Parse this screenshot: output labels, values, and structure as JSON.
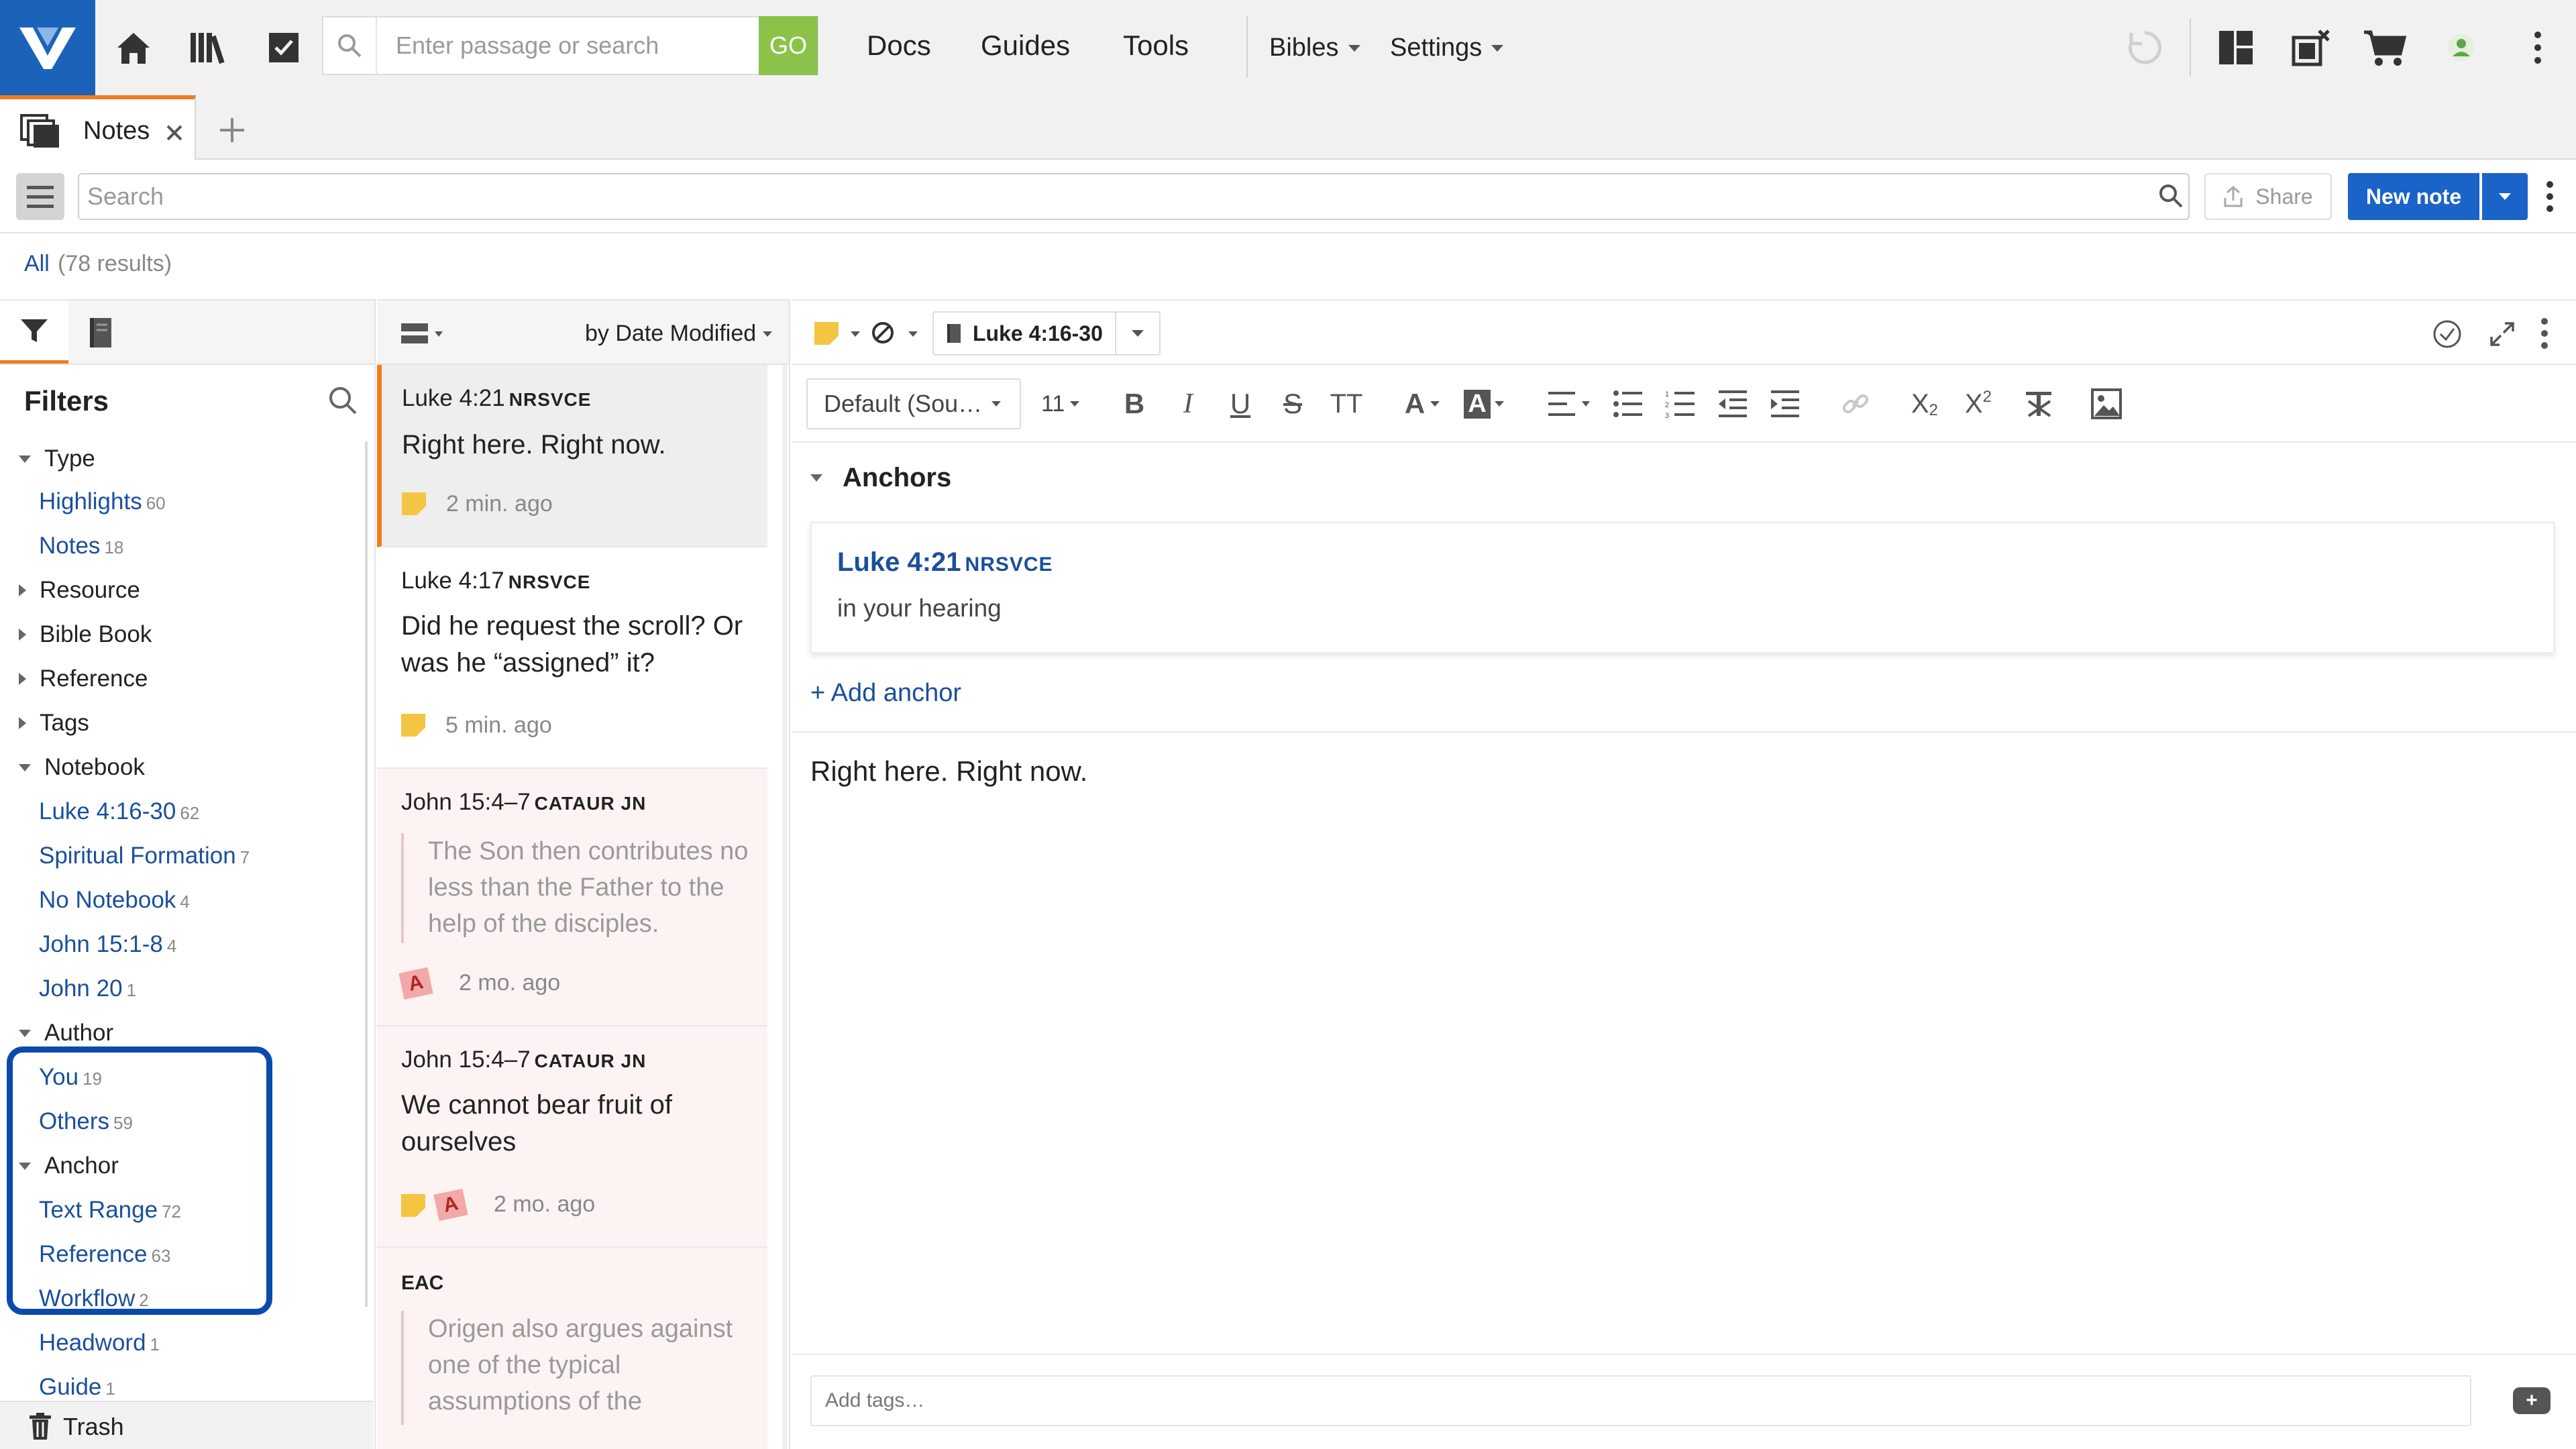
{
  "topbar": {
    "search_placeholder": "Enter passage or search",
    "go_label": "GO",
    "nav": [
      "Docs",
      "Guides",
      "Tools"
    ],
    "bibles_label": "Bibles",
    "settings_label": "Settings",
    "brand_color": "#1a63b8",
    "go_color": "#8bc34a"
  },
  "tab": {
    "label": "Notes",
    "accent": "#f07c1e"
  },
  "toolbar": {
    "search_placeholder": "Search",
    "share_label": "Share",
    "new_note_label": "New note",
    "new_note_color": "#1a63c8"
  },
  "results": {
    "all_label": "All",
    "count_label": "(78 results)"
  },
  "filters": {
    "title": "Filters",
    "groups": {
      "type": {
        "label": "Type",
        "items": [
          {
            "label": "Highlights",
            "count": "60"
          },
          {
            "label": "Notes",
            "count": "18"
          }
        ]
      },
      "resource": {
        "label": "Resource"
      },
      "bible_book": {
        "label": "Bible Book"
      },
      "reference": {
        "label": "Reference"
      },
      "tags": {
        "label": "Tags"
      },
      "notebook": {
        "label": "Notebook",
        "items": [
          {
            "label": "Luke 4:16-30",
            "count": "62"
          },
          {
            "label": "Spiritual Formation",
            "count": "7"
          },
          {
            "label": "No Notebook",
            "count": "4"
          },
          {
            "label": "John 15:1-8",
            "count": "4"
          },
          {
            "label": "John 20",
            "count": "1"
          }
        ]
      },
      "author": {
        "label": "Author",
        "items": [
          {
            "label": "You",
            "count": "19"
          },
          {
            "label": "Others",
            "count": "59"
          }
        ]
      },
      "anchor": {
        "label": "Anchor",
        "items": [
          {
            "label": "Text Range",
            "count": "72"
          },
          {
            "label": "Reference",
            "count": "63"
          },
          {
            "label": "Workflow",
            "count": "2"
          },
          {
            "label": "Headword",
            "count": "1"
          },
          {
            "label": "Guide",
            "count": "1"
          }
        ]
      }
    },
    "trash_label": "Trash",
    "highlight_color": "#0a4aad"
  },
  "list": {
    "sort_label": "by Date Modified",
    "cards": [
      {
        "ref": "Luke 4:21",
        "version": "NRSVCE",
        "title": "Right here. Right now.",
        "time": "2 min. ago"
      },
      {
        "ref": "Luke 4:17",
        "version": "NRSVCE",
        "title": "Did he request the scroll? Or was he “assigned” it?",
        "time": "5 min. ago"
      },
      {
        "ref": "John 15:4–7",
        "version": "CATAUR JN",
        "quote": "The Son then contributes no less than the Father to the help of the disciples.",
        "time": "2 mo. ago",
        "author_initial": "A"
      },
      {
        "ref": "John 15:4–7",
        "version": "CATAUR JN",
        "title": "We cannot bear fruit of ourselves",
        "time": "2 mo. ago",
        "author_initial": "A"
      },
      {
        "ref": "EAC",
        "quote": "Origen also argues against one of the typical assumptions of the"
      }
    ]
  },
  "editor": {
    "notebook_label": "Luke 4:16-30",
    "font_label": "Default (Sou…",
    "size_label": "11",
    "anchors_title": "Anchors",
    "anchor": {
      "ref": "Luke 4:21",
      "version": "NRSVCE",
      "text": "in your hearing"
    },
    "add_anchor_label": "+ Add anchor",
    "body": "Right here. Right now.",
    "tags_placeholder": "Add tags…"
  }
}
